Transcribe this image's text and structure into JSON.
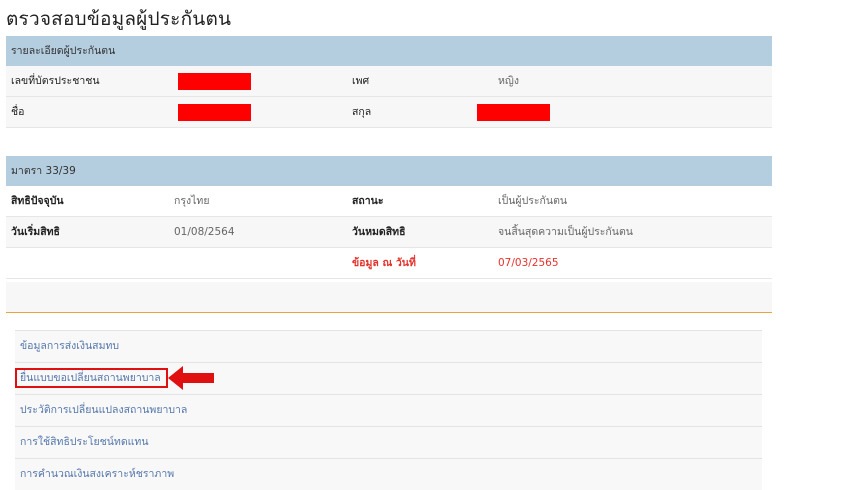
{
  "page": {
    "title": "ตรวจสอบข้อมูลผู้ประกันตน"
  },
  "personal": {
    "header": "รายละเอียดผู้ประกันตน",
    "id_label": "เลขที่บัตรประชาชน",
    "gender_label": "เพศ",
    "gender_value": "หญิง",
    "name_label": "ชื่อ",
    "surname_label": "สกุล"
  },
  "section": {
    "header": "มาตรา 33/39",
    "right_label": "สิทธิปัจจุบัน",
    "right_value": "กรุงไทย",
    "status_label": "สถานะ",
    "status_value": "เป็นผู้ประกันตน",
    "start_label": "วันเริ่มสิทธิ",
    "start_value": "01/08/2564",
    "end_label": "วันหมดสิทธิ",
    "end_value": "จนสิ้นสุดความเป็นผู้ประกันตน",
    "asof_label": "ข้อมูล ณ วันที่",
    "asof_value": "07/03/2565"
  },
  "menu": {
    "items": [
      "ข้อมูลการส่งเงินสมทบ",
      "ยื่นแบบขอเปลี่ยนสถานพยาบาล",
      "ประวัติการเปลี่ยนแปลงสถานพยาบาล",
      "การใช้สิทธิประโยชน์ทดแทน",
      "การคำนวณเงินสงเคราะห์ชราภาพ"
    ]
  },
  "colors": {
    "header_bg": "#b4cddf",
    "redaction": "#ff0000",
    "link": "#5577aa",
    "highlight": "#e01010"
  }
}
